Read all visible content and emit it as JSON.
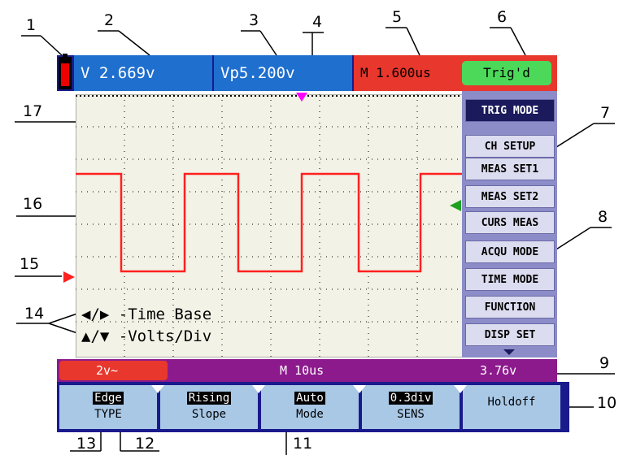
{
  "callouts": {
    "c1": "1",
    "c2": "2",
    "c3": "3",
    "c4": "4",
    "c5": "5",
    "c6": "6",
    "c7": "7",
    "c8": "8",
    "c9": "9",
    "c10": "10",
    "c11": "11",
    "c12": "12",
    "c13": "13",
    "c14": "14",
    "c15": "15",
    "c16": "16",
    "c17": "17"
  },
  "top_bar": {
    "voltage_readout": "V 2.669v",
    "peak_readout": "Vp5.200v",
    "timebase_readout": "M  1.600us",
    "trigger_status": "Trig'd"
  },
  "menu": {
    "items": [
      "TRIG MODE",
      "CH SETUP",
      "MEAS SET1",
      "MEAS SET2",
      "CURS MEAS",
      "ACQU MODE",
      "TIME MODE",
      "FUNCTION",
      "DISP SET"
    ],
    "active_index": 0
  },
  "hints": {
    "time_base": "-Time Base",
    "volts_div": "-Volts/Div"
  },
  "status_bar": {
    "channel_scale": "2v~",
    "timebase": "M 10us",
    "trigger_level": "3.76v"
  },
  "softkeys": [
    {
      "value": "Edge",
      "label": "TYPE"
    },
    {
      "value": "Rising",
      "label": "Slope"
    },
    {
      "value": "Auto",
      "label": "Mode"
    },
    {
      "value": "0.3div",
      "label": "SENS"
    },
    {
      "value": "",
      "label": "Holdoff"
    }
  ],
  "colors": {
    "waveform": "#ff2020",
    "trigger_marker": "#ff00ff",
    "level_marker": "#20a020",
    "ground_marker": "#ff2020"
  }
}
